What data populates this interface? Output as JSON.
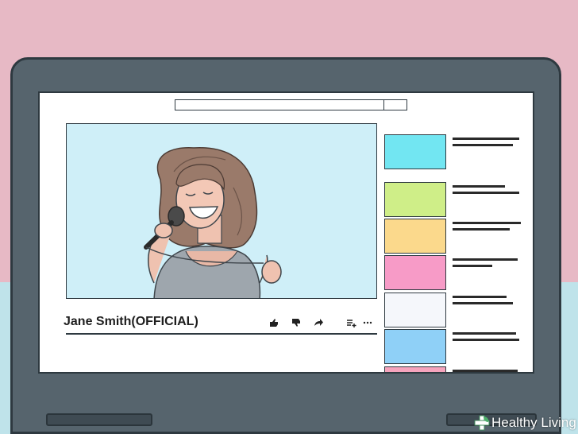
{
  "video": {
    "title": "Jane Smith(OFFICIAL)"
  },
  "actions": {
    "like_icon": "thumbs-up-icon",
    "dislike_icon": "thumbs-down-icon",
    "share_icon": "share-arrow-icon",
    "add_icon": "add-to-queue-icon",
    "more_icon": "more-icon"
  },
  "sidebar": {
    "thumbnails": [
      {
        "color": "#72e6f2"
      },
      {
        "color": "#cfee88"
      },
      {
        "color": "#fbd98c"
      },
      {
        "color": "#f79bc7"
      },
      {
        "color": "#f5f7fb"
      },
      {
        "color": "#8fd0f7"
      },
      {
        "color": "#f6a4bd"
      }
    ]
  },
  "watermark": {
    "brand": "Healthy Living"
  },
  "colors": {
    "wall_top": "#e7b9c5",
    "wall_bottom": "#bfe3ea",
    "laptop_body": "#56646d",
    "player_bg": "#cfeff8"
  }
}
